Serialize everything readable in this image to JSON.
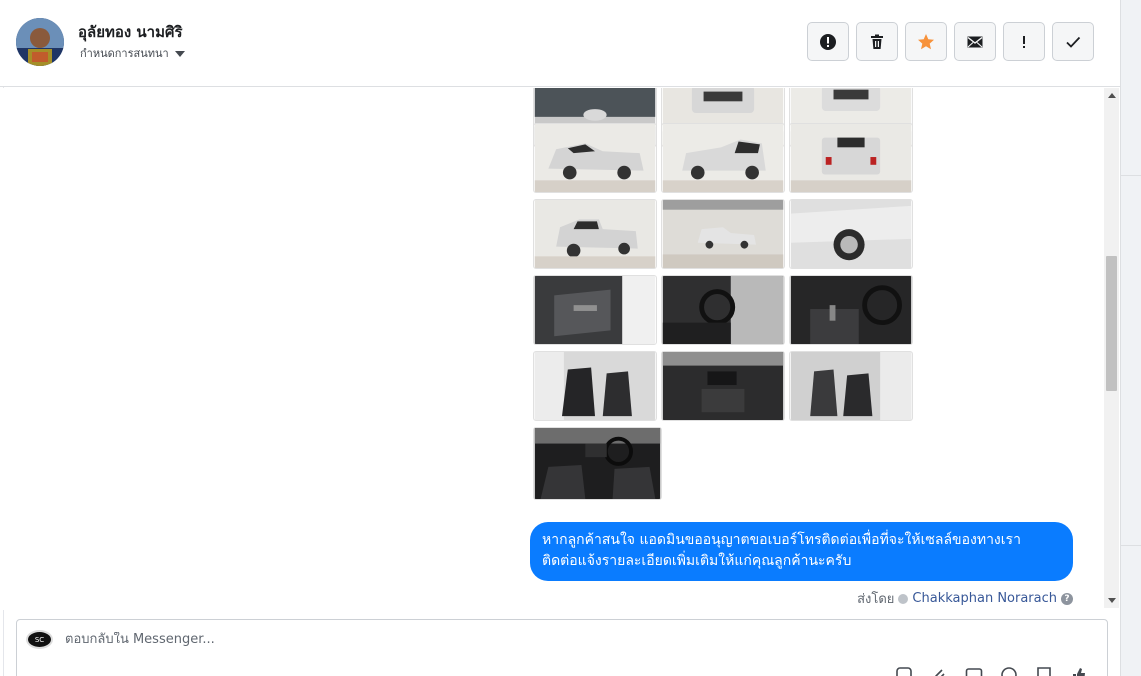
{
  "header": {
    "contact_name": "อุลัยทอง นามศิริ",
    "assign_label": "กำหนดการสนทนา",
    "actions": [
      {
        "name": "spam-button",
        "icon": "exclamation-circle-icon"
      },
      {
        "name": "delete-button",
        "icon": "trash-icon"
      },
      {
        "name": "star-button",
        "icon": "star-icon",
        "color": "#f7923b"
      },
      {
        "name": "mark-unread-button",
        "icon": "envelope-icon"
      },
      {
        "name": "flag-button",
        "icon": "exclamation-icon"
      },
      {
        "name": "mark-done-button",
        "icon": "check-icon"
      }
    ]
  },
  "thread": {
    "photo_count": 16,
    "message_lines": [
      "หากลูกค้าสนใจ แอดมินขออนุญาตขอเบอร์โทรติดต่อเพื่อที่จะให้เซลล์ของทางเรา",
      "ติดต่อแจ้งรายละเอียดเพิ่มเติมให้แก่คุณลูกค้านะครับ"
    ],
    "sent_by_label": "ส่งโดย",
    "sent_by_name": "Chakkaphan Norarach",
    "bubble_color": "#0a7cff"
  },
  "composer": {
    "placeholder": "ตอบกลับใน Messenger..."
  }
}
